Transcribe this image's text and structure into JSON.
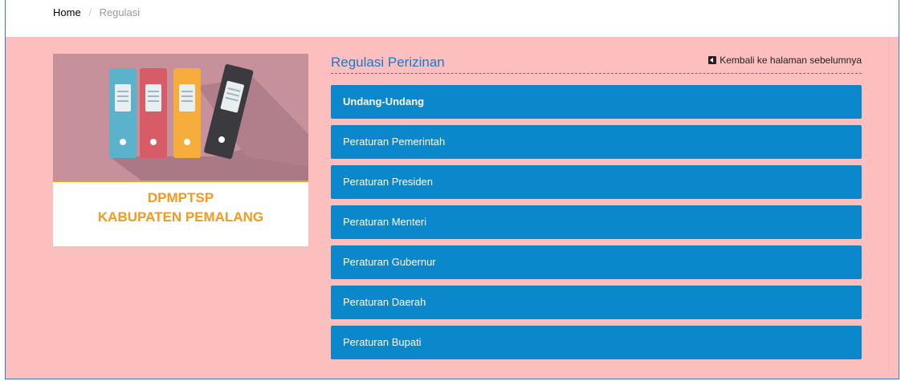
{
  "breadcrumb": {
    "home": "Home",
    "separator": "/",
    "current": "Regulasi"
  },
  "card": {
    "title_line1": "DPMPTSP",
    "title_line2": "KABUPATEN PEMALANG",
    "image_icon": "binders-icon"
  },
  "section": {
    "title": "Regulasi Perizinan",
    "back_label": "Kembali ke halaman sebelumnya",
    "back_icon": "caret-left-square-icon"
  },
  "regulations": [
    {
      "label": "Undang-Undang"
    },
    {
      "label": "Peraturan Pemerintah"
    },
    {
      "label": "Peraturan Presiden"
    },
    {
      "label": "Peraturan Menteri"
    },
    {
      "label": "Peraturan Gubernur"
    },
    {
      "label": "Peraturan Daerah"
    },
    {
      "label": "Peraturan Bupati"
    }
  ],
  "colors": {
    "background": "#fdbebe",
    "accent": "#0b87cb",
    "title": "#1e78c8",
    "orange": "#f39a1f"
  }
}
